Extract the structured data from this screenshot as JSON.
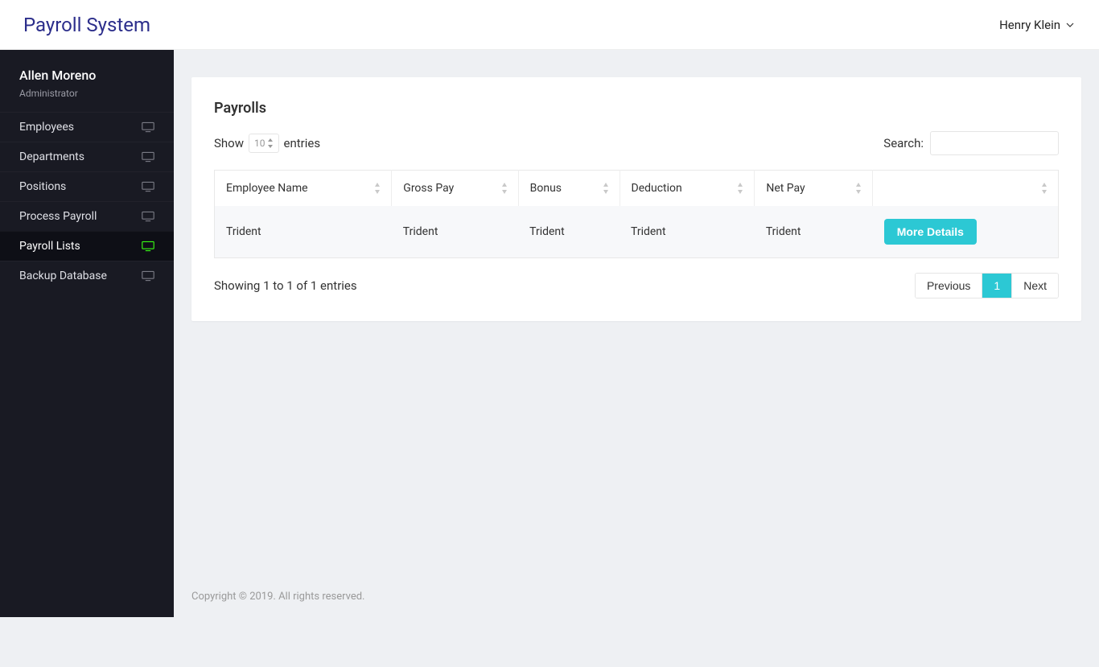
{
  "brand": "Payroll System",
  "header": {
    "user_name": "Henry Klein"
  },
  "sidebar": {
    "profile": {
      "name": "Allen Moreno",
      "role": "Administrator"
    },
    "items": [
      {
        "label": "Employees",
        "active": false
      },
      {
        "label": "Departments",
        "active": false
      },
      {
        "label": "Positions",
        "active": false
      },
      {
        "label": "Process Payroll",
        "active": false
      },
      {
        "label": "Payroll Lists",
        "active": true
      },
      {
        "label": "Backup Database",
        "active": false
      }
    ]
  },
  "main": {
    "card_title": "Payrolls",
    "show_label_pre": "Show",
    "show_label_post": "entries",
    "entries_value": "10",
    "search_label": "Search:",
    "columns": [
      "Employee Name",
      "Gross Pay",
      "Bonus",
      "Deduction",
      "Net Pay",
      ""
    ],
    "rows": [
      {
        "employee_name": "Trident",
        "gross_pay": "Trident",
        "bonus": "Trident",
        "deduction": "Trident",
        "net_pay": "Trident",
        "action_label": "More Details"
      }
    ],
    "info": "Showing 1 to 1 of 1 entries",
    "pagination": {
      "prev": "Previous",
      "pages": [
        "1"
      ],
      "next": "Next"
    }
  },
  "footer": "Copyright © 2019. All rights reserved."
}
